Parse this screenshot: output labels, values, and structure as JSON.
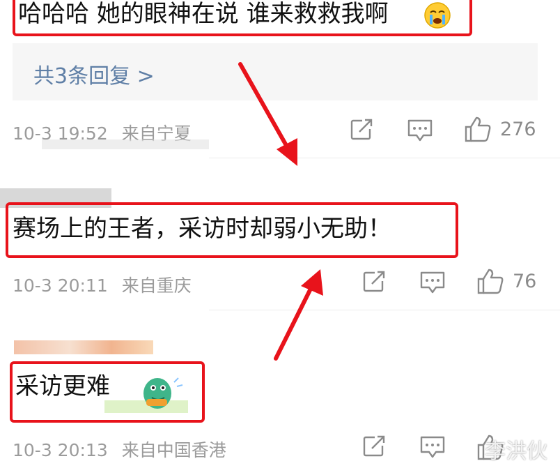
{
  "comments": [
    {
      "text": "哈哈哈 她的眼神在说 谁来救救我啊",
      "emoji": "crying-face-emoji",
      "replies_link": "共3条回复 >",
      "timestamp": "10-3 19:52",
      "location": "来自宁夏",
      "likes": "276"
    },
    {
      "text": "赛场上的王者，采访时却弱小无助！",
      "timestamp": "10-3 20:11",
      "location": "来自重庆",
      "likes": "76"
    },
    {
      "text": "采访更难",
      "sticker": "dinosaur-sticker",
      "timestamp": "10-3 20:13",
      "location": "来自中国香港",
      "likes": ""
    }
  ],
  "icons": [
    "share-icon",
    "comment-icon",
    "like-icon"
  ],
  "watermark": "李洪伙",
  "colors": {
    "highlight_box": "#e8131b",
    "arrow": "#e8131b",
    "link": "#5f7fa6",
    "meta": "#9b9b9b"
  }
}
